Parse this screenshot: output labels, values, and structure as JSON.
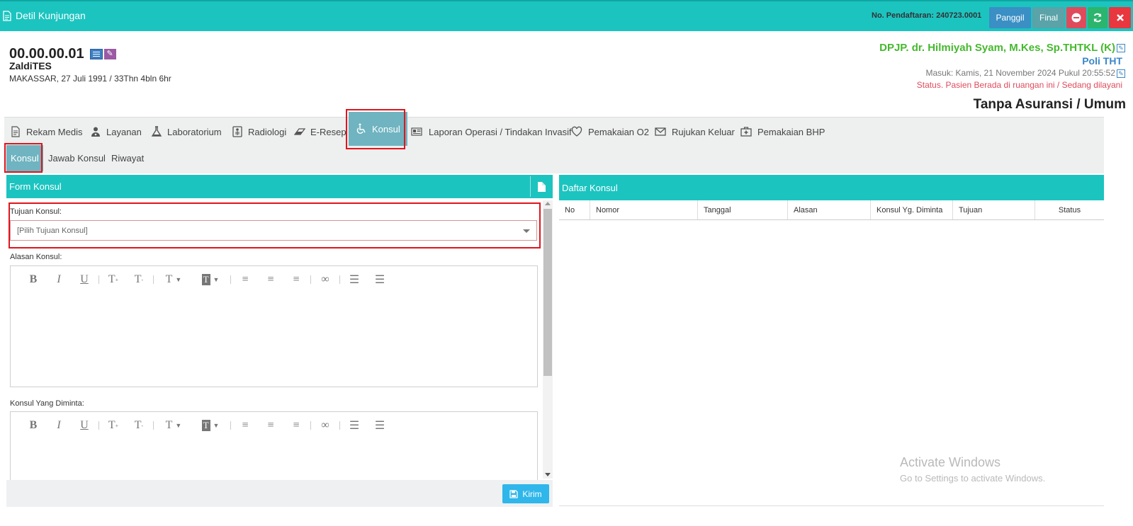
{
  "topbar": {
    "title": "Detil Kunjungan",
    "registration": "No. Pendaftaran: 240723.0001",
    "panggil_label": "Panggil",
    "final_label": "Final",
    "color": "#1cc4c0"
  },
  "patient": {
    "id": "00.00.00.01",
    "name": "ZaldiTES",
    "birth": "MAKASSAR, 27 Juli 1991 / 33Thn 4bln 6hr"
  },
  "visit": {
    "dpjp": "DPJP. dr. Hilmiyah Syam, M.Kes, Sp.THTKL (K)",
    "poli": "Poli THT",
    "masuk": "Masuk: Kamis, 21 November 2024 Pukul 20:55:52",
    "status": "Status. Pasien Berada di ruangan ini / Sedang dilayani",
    "insurance": "Tanpa Asuransi / Umum"
  },
  "tabs": [
    {
      "label": "Rekam Medis",
      "icon": "document-icon"
    },
    {
      "label": "Layanan",
      "icon": "doctor-icon"
    },
    {
      "label": "Laboratorium",
      "icon": "flask-icon"
    },
    {
      "label": "Radiologi",
      "icon": "xray-icon"
    },
    {
      "label": "E-Resep",
      "icon": "eraser-icon"
    },
    {
      "label": "Konsul",
      "icon": "wheelchair-icon",
      "active": true
    },
    {
      "label": "Laporan Operasi / Tindakan Invasif",
      "icon": "newspaper-icon"
    },
    {
      "label": "Pemakaian O2",
      "icon": "heart-icon"
    },
    {
      "label": "Rujukan Keluar",
      "icon": "envelope-icon"
    },
    {
      "label": "Pemakaian BHP",
      "icon": "medkit-icon"
    }
  ],
  "subtabs": [
    {
      "label": "Konsul",
      "active": true
    },
    {
      "label": "Jawab Konsul"
    },
    {
      "label": "Riwayat"
    }
  ],
  "form": {
    "title": "Form Konsul",
    "tujuan_label": "Tujuan Konsul:",
    "tujuan_value": "[Pilih Tujuan Konsul]",
    "alasan_label": "Alasan Konsul:",
    "diminta_label": "Konsul Yang Diminta:",
    "submit_label": "Kirim"
  },
  "daftar": {
    "title": "Daftar Konsul",
    "columns": [
      "No",
      "Nomor",
      "Tanggal",
      "Alasan",
      "Konsul Yg. Diminta",
      "Tujuan",
      "Status"
    ],
    "rows": []
  },
  "watermark": {
    "line1": "Activate Windows",
    "line2": "Go to Settings to activate Windows."
  }
}
